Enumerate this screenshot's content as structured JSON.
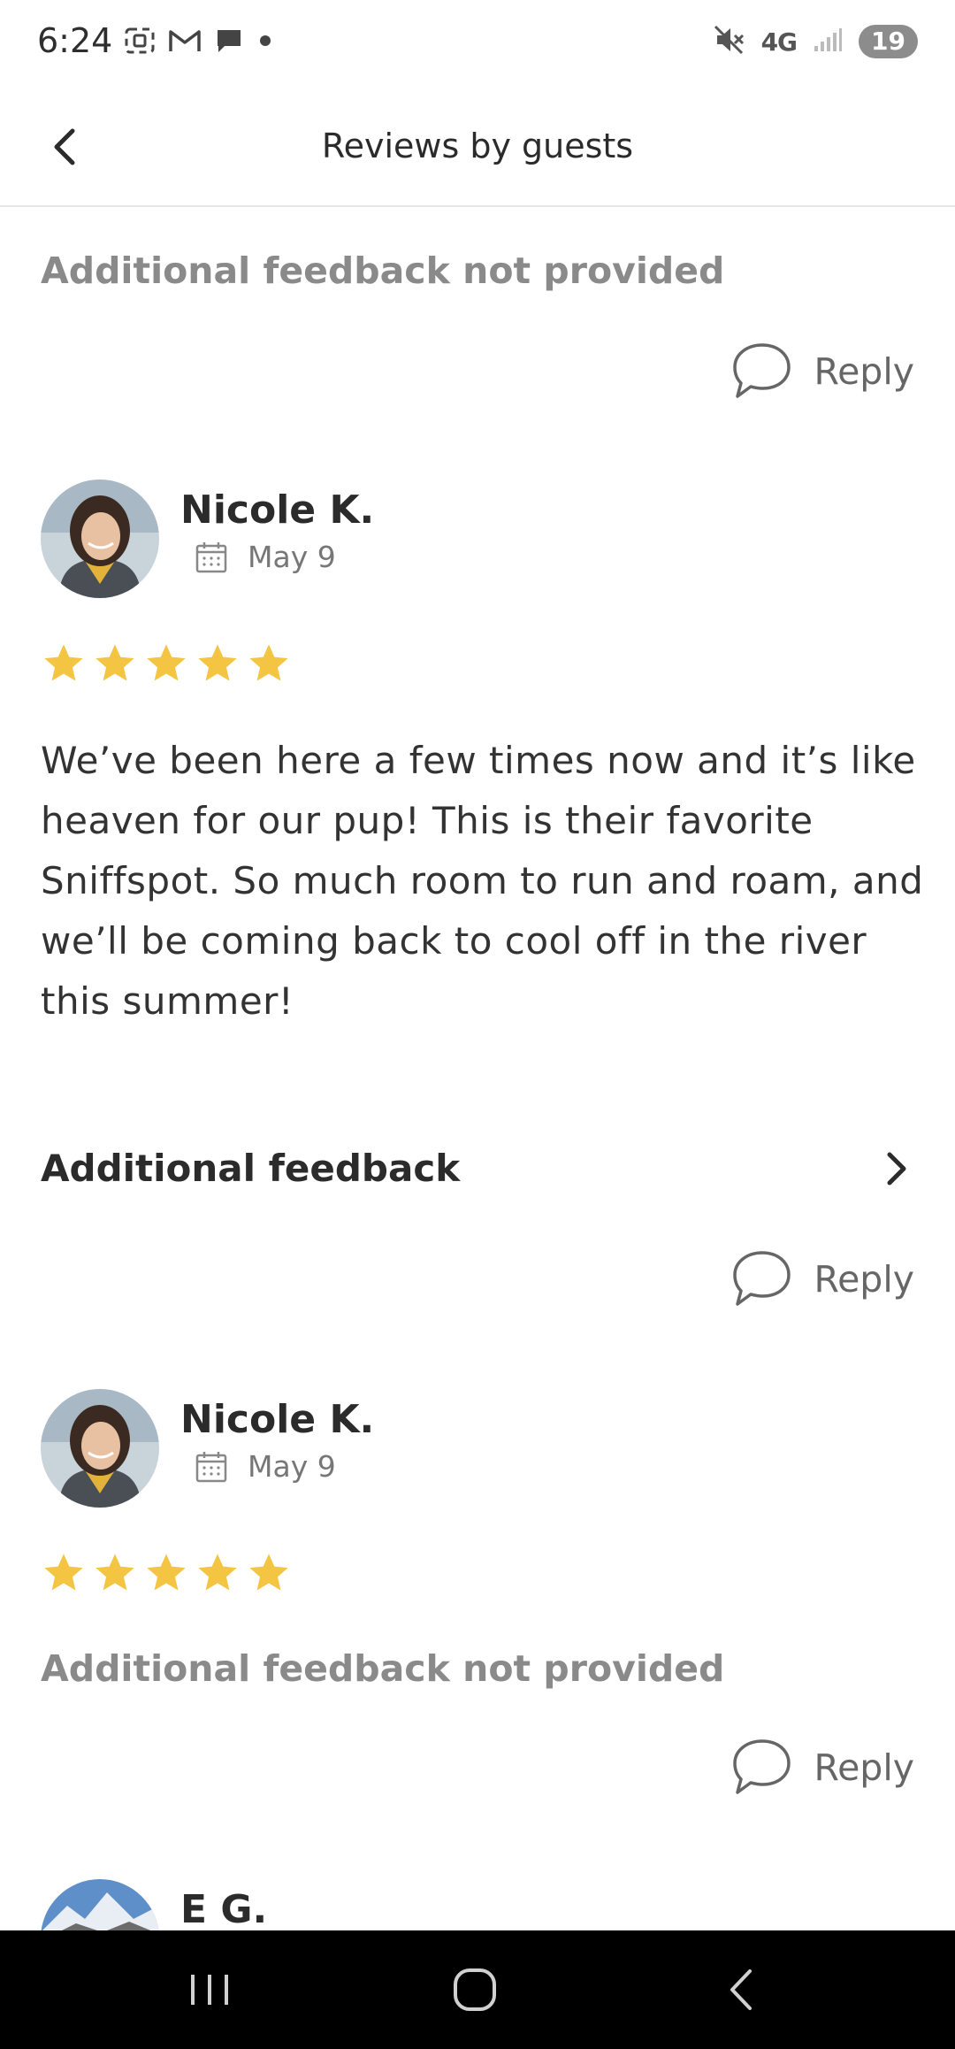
{
  "status_bar": {
    "time": "6:24",
    "network": "4G",
    "battery": "19",
    "icons": [
      "screenshot-icon",
      "gmail-icon",
      "chat-icon",
      "dot-icon",
      "mute-icon",
      "signal-icon"
    ]
  },
  "header": {
    "title": "Reviews by guests",
    "back_icon": "chevron-left-icon"
  },
  "reviews": [
    {
      "feedback_text": "Additional feedback not provided",
      "reply_label": "Reply"
    },
    {
      "name": "Nicole K.",
      "date": "May 9",
      "rating": 5,
      "text": "We’ve been here a few times now and it’s like heaven for our pup! This is their favorite Sniffspot. So much room to run and roam, and we’ll be coming back to cool off in the river this summer!",
      "additional_label": "Additional feedback",
      "reply_label": "Reply"
    },
    {
      "name": "Nicole K.",
      "date": "May 9",
      "rating": 5,
      "feedback_text": "Additional feedback not provided",
      "reply_label": "Reply"
    },
    {
      "name": "E G."
    }
  ],
  "colors": {
    "star": "#f4c542",
    "muted_text": "#8a8a8a",
    "nav_bar": "#000000"
  }
}
